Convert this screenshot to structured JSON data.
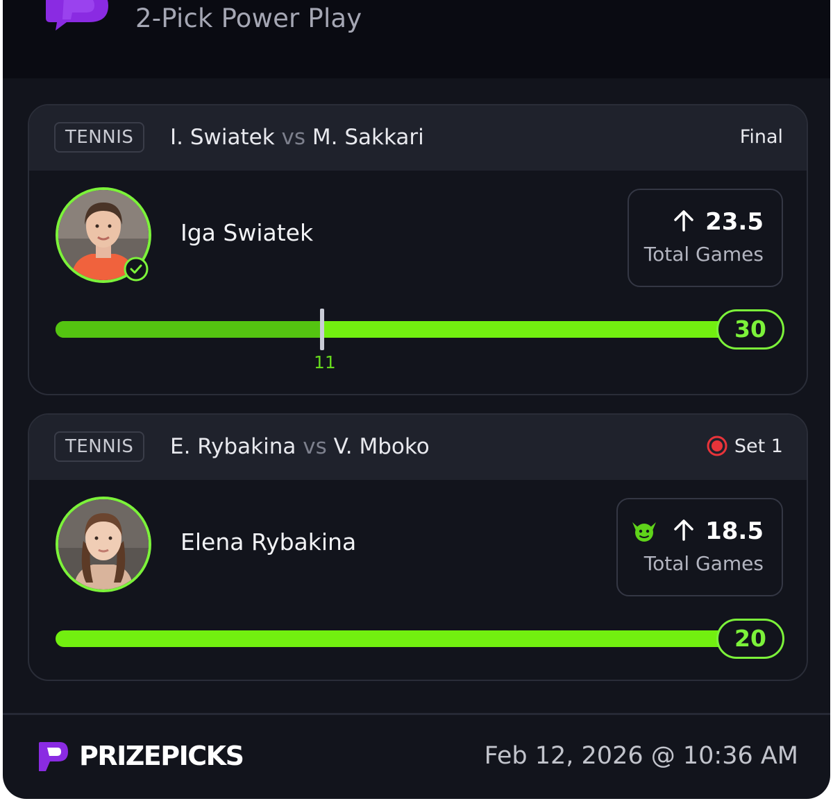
{
  "header": {
    "title": "2-Pick Power Play",
    "logo_icon": "prizepicks-logo-icon"
  },
  "picks": [
    {
      "sport": "TENNIS",
      "player1": "I. Swiatek",
      "vs": "vs",
      "player2": "M. Sakkari",
      "status": "Final",
      "player_name": "Iga Swiatek",
      "direction_icon": "arrow-up-icon",
      "line": "23.5",
      "stat": "Total Games",
      "current": "30",
      "marker_value": "11",
      "checked": true
    },
    {
      "sport": "TENNIS",
      "player1": "E. Rybakina",
      "vs": "vs",
      "player2": "V. Mboko",
      "status": "Set 1",
      "status_icon": "live-dot-icon",
      "player_name": "Elena Rybakina",
      "badge_icon": "goblin-icon",
      "direction_icon": "arrow-up-icon",
      "line": "18.5",
      "stat": "Total Games",
      "current": "20"
    }
  ],
  "footer": {
    "brand": "PRIZEPICKS",
    "timestamp": "Feb 12, 2026 @ 10:36 AM"
  },
  "colors": {
    "accent_green": "#7cf23a",
    "bar_green": "#72ef10",
    "brand_purple": "#8a2be2",
    "live_red": "#e8343a",
    "background": "#12141c"
  }
}
